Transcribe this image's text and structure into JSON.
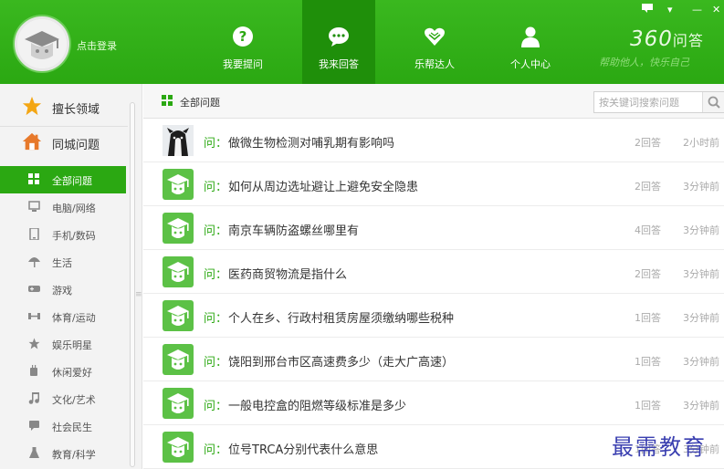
{
  "header": {
    "login_text": "点击登录",
    "tabs": [
      {
        "label": "我要提问",
        "icon": "question-icon"
      },
      {
        "label": "我来回答",
        "icon": "chat-bubble-icon",
        "active": true
      },
      {
        "label": "乐帮达人",
        "icon": "handshake-heart-icon"
      },
      {
        "label": "个人中心",
        "icon": "person-icon"
      }
    ],
    "brand_number": "360",
    "brand_text": "问答",
    "slogan": "帮助他人，快乐自己",
    "window_controls": {
      "dropdown": "▾",
      "menu": "▾",
      "minimize": "—",
      "close": "✕"
    },
    "accent_color": "#2ba812"
  },
  "sidebar": {
    "top_items": [
      {
        "label": "擅长领域",
        "icon": "star-icon"
      },
      {
        "label": "同城问题",
        "icon": "house-icon"
      }
    ],
    "categories": [
      {
        "label": "全部问题",
        "icon": "grid-icon",
        "active": true
      },
      {
        "label": "电脑/网络",
        "icon": "monitor-icon"
      },
      {
        "label": "手机/数码",
        "icon": "phone-icon"
      },
      {
        "label": "生活",
        "icon": "umbrella-icon"
      },
      {
        "label": "游戏",
        "icon": "gamepad-icon"
      },
      {
        "label": "体育/运动",
        "icon": "dumbbell-icon"
      },
      {
        "label": "娱乐明星",
        "icon": "star-icon"
      },
      {
        "label": "休闲爱好",
        "icon": "cup-icon"
      },
      {
        "label": "文化/艺术",
        "icon": "music-note-icon"
      },
      {
        "label": "社会民生",
        "icon": "speech-icon"
      },
      {
        "label": "教育/科学",
        "icon": "flask-icon"
      }
    ]
  },
  "main": {
    "section_title": "全部问题",
    "search_placeholder": "按关键词搜索问题",
    "question_prefix": "问：",
    "questions": [
      {
        "title": "做微生物检测对哺乳期有影响吗",
        "answers": "2回答",
        "time": "2小时前",
        "avatar": "dog-photo"
      },
      {
        "title": "如何从周边选址避让上避免安全隐患",
        "answers": "2回答",
        "time": "3分钟前",
        "avatar": "graduate-icon"
      },
      {
        "title": "南京车辆防盗螺丝哪里有",
        "answers": "4回答",
        "time": "3分钟前",
        "avatar": "graduate-icon"
      },
      {
        "title": "医药商贸物流是指什么",
        "answers": "2回答",
        "time": "3分钟前",
        "avatar": "graduate-icon"
      },
      {
        "title": "个人在乡、行政村租赁房屋须缴纳哪些税种",
        "answers": "1回答",
        "time": "3分钟前",
        "avatar": "graduate-icon"
      },
      {
        "title": "饶阳到邢台市区高速费多少（走大广高速）",
        "answers": "1回答",
        "time": "3分钟前",
        "avatar": "graduate-icon"
      },
      {
        "title": "一般电控盒的阻燃等级标准是多少",
        "answers": "1回答",
        "time": "3分钟前",
        "avatar": "graduate-icon"
      },
      {
        "title": "位号TRCA分别代表什么意思",
        "answers": "1回答",
        "time": "3分钟前",
        "avatar": "graduate-icon"
      }
    ]
  },
  "watermark": "最需教育"
}
